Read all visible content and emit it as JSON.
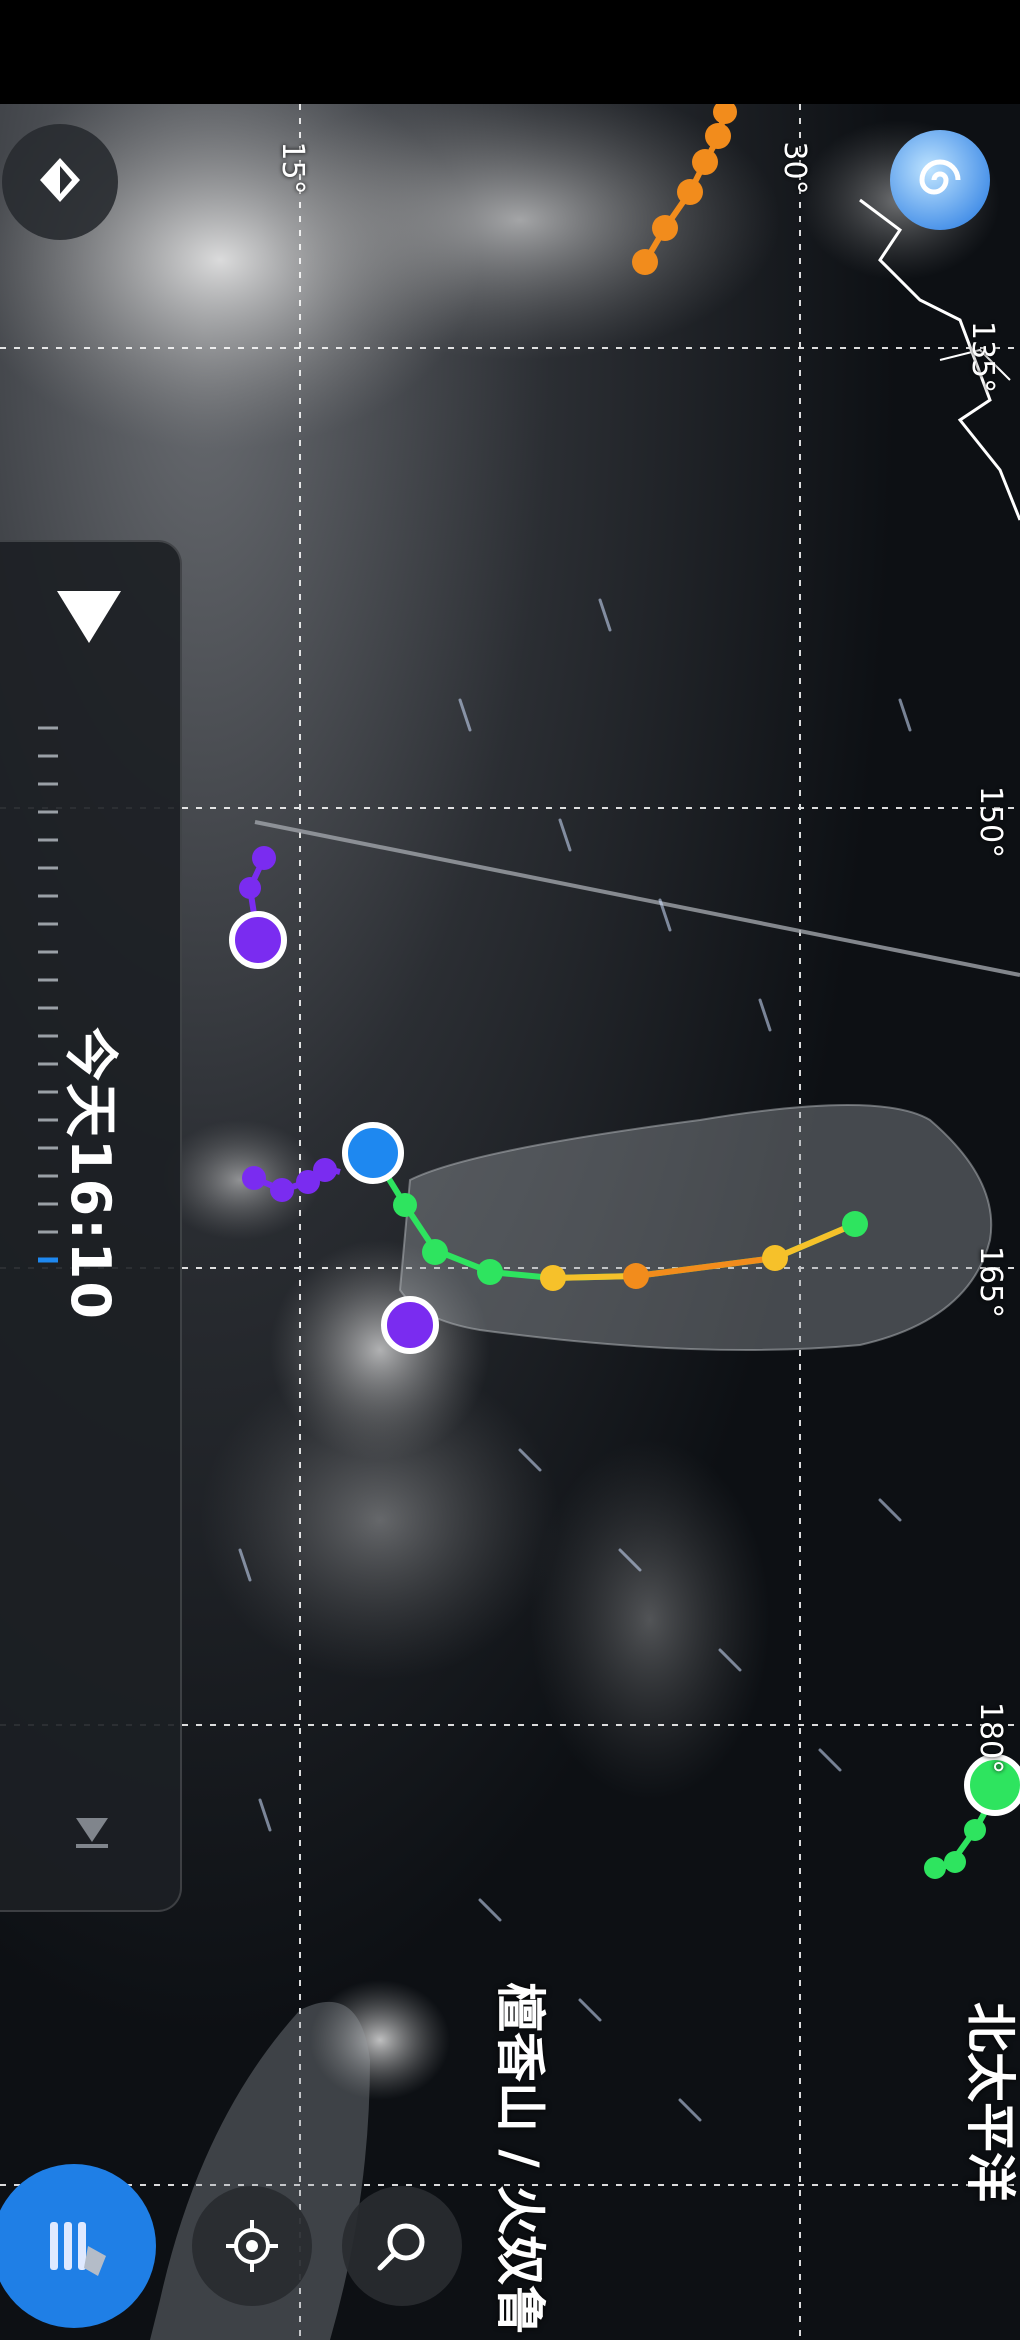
{
  "map": {
    "longitude_labels": [
      "150°",
      "165°",
      "180°",
      "135°"
    ],
    "latitude_labels": [
      "15°",
      "30°"
    ],
    "place_labels": [
      "檀香山 / 火奴鲁",
      "北太平洋"
    ]
  },
  "timeline": {
    "time_label": "今天16:10"
  },
  "colors": {
    "track_green": "#2ee45f",
    "track_yellow": "#f6c12a",
    "track_orange": "#f28c1c",
    "purple_storm": "#7a2cf0",
    "current_blue": "#1e88f0",
    "layer_button": "#1f7fe6"
  },
  "icons": {
    "layers": "diamond-layers-icon",
    "logo": "spiral-logo-icon",
    "play": "play-triangle-icon",
    "end_marker": "end-marker-icon",
    "menu_layers": "layers-menu-icon",
    "locate": "crosshair-icon",
    "search": "search-icon"
  }
}
